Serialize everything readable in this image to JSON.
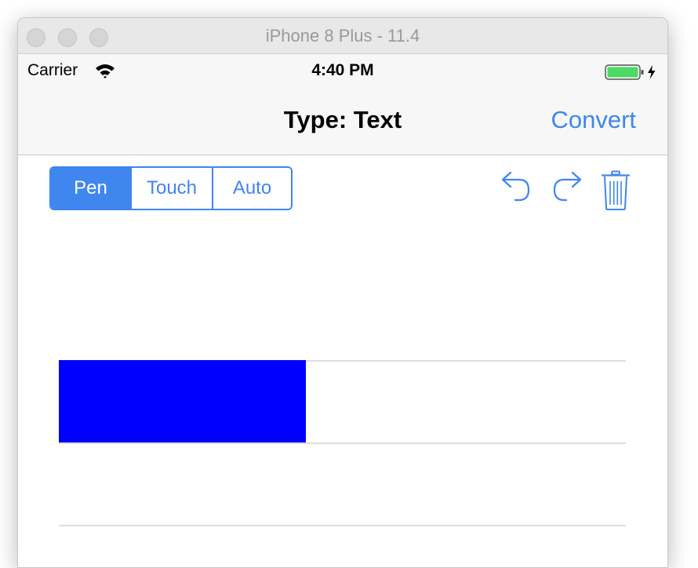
{
  "window": {
    "title": "iPhone 8 Plus - 11.4"
  },
  "status_bar": {
    "carrier": "Carrier",
    "time": "4:40 PM",
    "battery_level": 1.0,
    "charging": true
  },
  "nav_bar": {
    "title": "Type: Text",
    "convert_label": "Convert"
  },
  "input_mode": {
    "options": [
      "Pen",
      "Touch",
      "Auto"
    ],
    "selected": "Pen"
  },
  "toolbar": {
    "undo_icon": "undo-arrow-icon",
    "redo_icon": "redo-arrow-icon",
    "clear_icon": "trash-icon"
  },
  "writing_area": {
    "ink_fill_fraction": 0.435
  },
  "colors": {
    "accent": "#3f86ef",
    "ink": "#0000ff",
    "rule_line": "#dedede",
    "bar_background": "#f7f7f7"
  }
}
